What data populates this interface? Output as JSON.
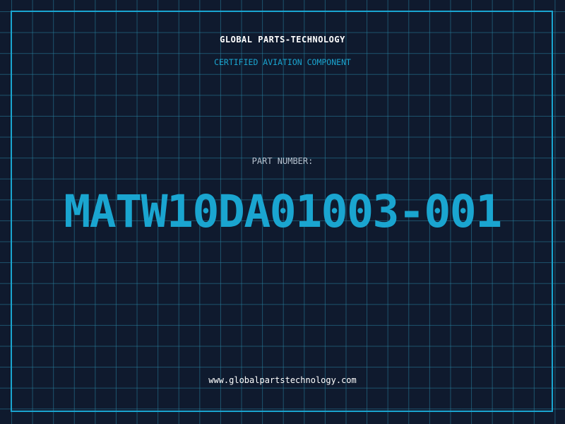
{
  "header": {
    "company": "GLOBAL PARTS-TECHNOLOGY",
    "subtitle": "CERTIFIED AVIATION COMPONENT"
  },
  "part": {
    "label": "PART NUMBER:",
    "number": "MATW10DA01003-001"
  },
  "footer": {
    "website": "www.globalpartstechnology.com"
  },
  "colors": {
    "background": "#0f1a2e",
    "accent": "#1aa5d0",
    "grid": "#1f6d86",
    "text": "#ffffff",
    "label": "#b6c2cf"
  }
}
